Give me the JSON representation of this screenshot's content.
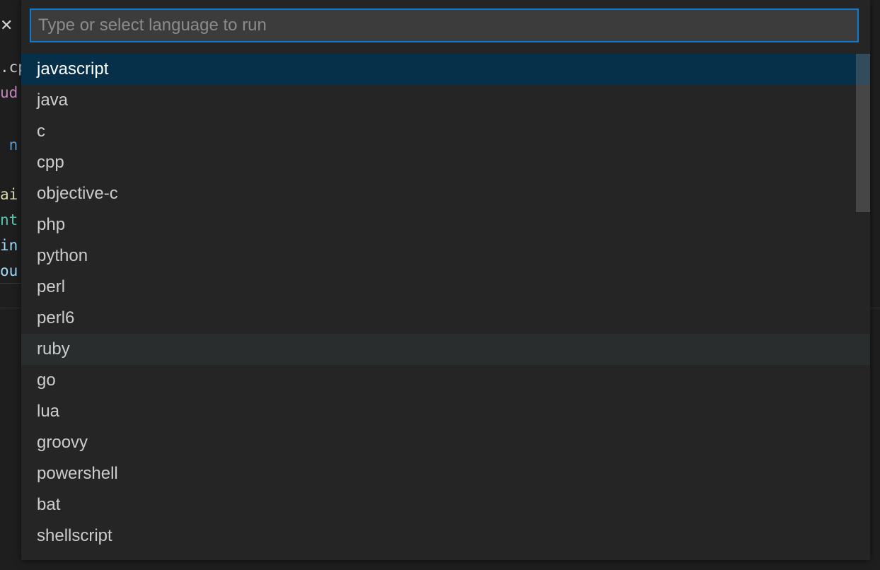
{
  "editor": {
    "code_fragments": [
      {
        "text": ".cp",
        "color": "#cccccc"
      },
      {
        "text": "ud",
        "color": "#c586c0"
      },
      {
        "text": " n",
        "color": "#569cd6"
      },
      {
        "text": "ai",
        "color": "#dcdcaa"
      },
      {
        "text": "nt",
        "color": "#4ec9b0"
      },
      {
        "text": "in",
        "color": "#9cdcfe"
      },
      {
        "text": "ou",
        "color": "#9cdcfe"
      }
    ]
  },
  "quick_pick": {
    "placeholder": "Type or select language to run",
    "value": "",
    "accent_color": "#0e7ad3",
    "selected_index": 0,
    "hovered_index": 9,
    "items": [
      "javascript",
      "java",
      "c",
      "cpp",
      "objective-c",
      "php",
      "python",
      "perl",
      "perl6",
      "ruby",
      "go",
      "lua",
      "groovy",
      "powershell",
      "bat",
      "shellscript"
    ]
  }
}
